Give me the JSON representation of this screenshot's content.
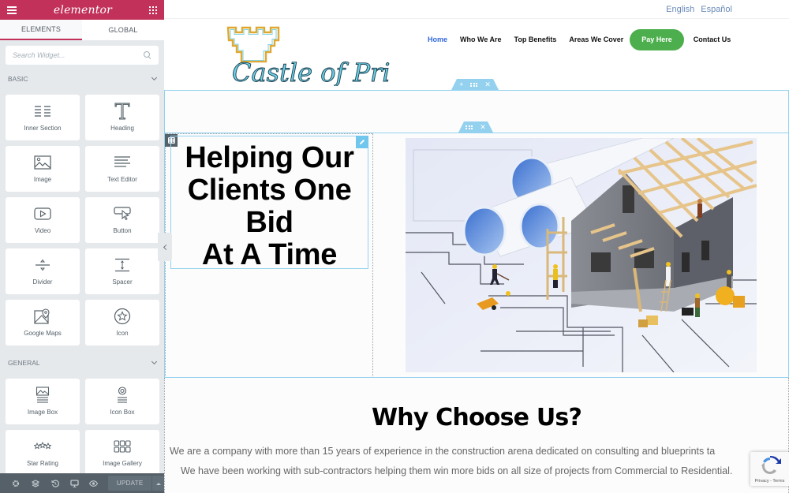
{
  "panel": {
    "brand": "elementor",
    "tabs": [
      {
        "label": "ELEMENTS",
        "active": true
      },
      {
        "label": "GLOBAL",
        "active": false
      }
    ],
    "search": {
      "placeholder": "Search Widget...",
      "value": ""
    },
    "categories": [
      {
        "title": "BASIC",
        "widgets": [
          {
            "label": "Inner Section",
            "icon": "inner-section-icon"
          },
          {
            "label": "Heading",
            "icon": "heading-icon"
          },
          {
            "label": "Image",
            "icon": "image-icon"
          },
          {
            "label": "Text Editor",
            "icon": "text-editor-icon"
          },
          {
            "label": "Video",
            "icon": "video-icon"
          },
          {
            "label": "Button",
            "icon": "button-icon"
          },
          {
            "label": "Divider",
            "icon": "divider-icon"
          },
          {
            "label": "Spacer",
            "icon": "spacer-icon"
          },
          {
            "label": "Google Maps",
            "icon": "google-maps-icon"
          },
          {
            "label": "Icon",
            "icon": "star-icon"
          }
        ]
      },
      {
        "title": "GENERAL",
        "widgets": [
          {
            "label": "Image Box",
            "icon": "image-box-icon"
          },
          {
            "label": "Icon Box",
            "icon": "icon-box-icon"
          },
          {
            "label": "Star Rating",
            "icon": "star-rating-icon"
          },
          {
            "label": "Image Gallery",
            "icon": "image-gallery-icon"
          }
        ]
      }
    ],
    "footer": {
      "icons": [
        "settings-icon",
        "navigator-icon",
        "history-icon",
        "responsive-icon",
        "preview-icon"
      ],
      "update_label": "UPDATE"
    }
  },
  "site": {
    "languages": [
      "English",
      "Español"
    ],
    "logo_text": "Castle of Prints",
    "nav": [
      {
        "label": "Home",
        "active": true
      },
      {
        "label": "Who We Are",
        "active": false
      },
      {
        "label": "Top Benefits",
        "active": false
      },
      {
        "label": "Areas We Cover",
        "active": false
      },
      {
        "label": "Pay Here",
        "active": false,
        "button": true
      },
      {
        "label": "Contact Us",
        "active": false
      }
    ],
    "hero": {
      "title_lines": [
        "Helping Our",
        "Clients One",
        "Bid",
        "At A Time"
      ],
      "image_alt": "Miniature construction workers building a house on blueprints"
    },
    "why": {
      "title": "Why Choose Us?",
      "paragraphs": [
        "We are a company with more than 15 years of experience in the construction arena dedicated on consulting and blueprints ta",
        "We have been working with sub-contractors helping them win more bids on all size of projects from Commercial to Residential."
      ]
    },
    "recaptcha": {
      "text": "Privacy - Terms"
    }
  },
  "colors": {
    "elementor_brand": "#c2315a",
    "handle_blue": "#93d1ef",
    "nav_active": "#2f66d9",
    "pay_button": "#4cae4c"
  }
}
